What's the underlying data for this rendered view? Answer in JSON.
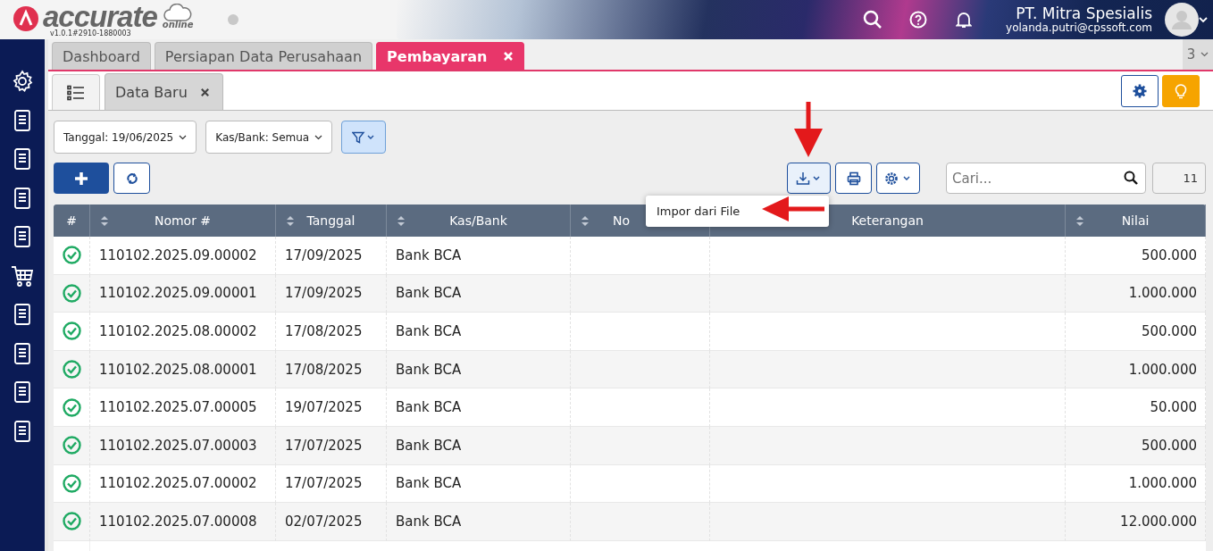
{
  "app": {
    "logo_text": "accurate",
    "logo_sub": "online",
    "version": "v1.0.1#2910-1880003"
  },
  "user": {
    "company": "PT. Mitra Spesialis",
    "email": "yolanda.putri@cpssoft.com"
  },
  "tabs": [
    {
      "label": "Dashboard",
      "selected": false,
      "closable": false
    },
    {
      "label": "Persiapan Data Perusahaan",
      "selected": false,
      "closable": false
    },
    {
      "label": "Pembayaran",
      "selected": true,
      "closable": true
    }
  ],
  "tab_count": "3",
  "subtabs": [
    {
      "label": "Data Baru"
    }
  ],
  "filters": [
    {
      "label": "Tanggal: 19/06/2025"
    },
    {
      "label": "Kas/Bank: Semua"
    }
  ],
  "search": {
    "placeholder": "Cari..."
  },
  "record_count": "11",
  "import_menu": {
    "items": [
      "Impor dari File"
    ]
  },
  "table": {
    "columns": [
      {
        "label": "#",
        "sortable": false
      },
      {
        "label": "Nomor #",
        "sortable": true
      },
      {
        "label": "Tanggal",
        "sortable": true
      },
      {
        "label": "Kas/Bank",
        "sortable": true
      },
      {
        "label": "No",
        "sortable": true
      },
      {
        "label": "Keterangan"
      },
      {
        "label": "Nilai",
        "sortable": true
      }
    ],
    "rows": [
      {
        "number": "110102.2025.09.00002",
        "date": "17/09/2025",
        "bank": "Bank BCA",
        "value": "500.000"
      },
      {
        "number": "110102.2025.09.00001",
        "date": "17/09/2025",
        "bank": "Bank BCA",
        "value": "1.000.000"
      },
      {
        "number": "110102.2025.08.00002",
        "date": "17/08/2025",
        "bank": "Bank BCA",
        "value": "500.000"
      },
      {
        "number": "110102.2025.08.00001",
        "date": "17/08/2025",
        "bank": "Bank BCA",
        "value": "1.000.000"
      },
      {
        "number": "110102.2025.07.00005",
        "date": "19/07/2025",
        "bank": "Bank BCA",
        "value": "50.000"
      },
      {
        "number": "110102.2025.07.00003",
        "date": "17/07/2025",
        "bank": "Bank BCA",
        "value": "500.000"
      },
      {
        "number": "110102.2025.07.00002",
        "date": "17/07/2025",
        "bank": "Bank BCA",
        "value": "1.000.000"
      },
      {
        "number": "110102.2025.07.00008",
        "date": "02/07/2025",
        "bank": "Bank BCA",
        "value": "12.000.000"
      }
    ]
  }
}
